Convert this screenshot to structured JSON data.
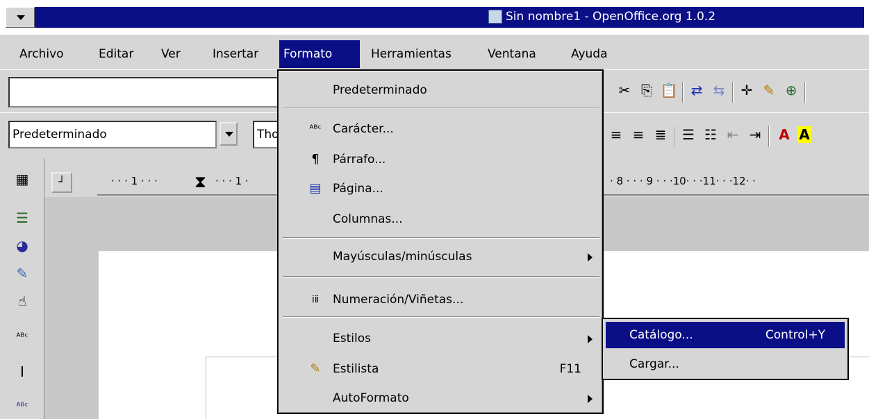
{
  "window": {
    "title": "Sin nombre1 - OpenOffice.org 1.0.2"
  },
  "menubar": {
    "items": [
      {
        "label": "Archivo"
      },
      {
        "label": "Editar"
      },
      {
        "label": "Ver"
      },
      {
        "label": "Insertar"
      },
      {
        "label": "Formato"
      },
      {
        "label": "Herramientas"
      },
      {
        "label": "Ventana"
      },
      {
        "label": "Ayuda"
      }
    ]
  },
  "toolbar": {
    "paragraph_style": "Predeterminado",
    "font_name": "Tho"
  },
  "ruler": {
    "left_text": "· · · 1 · · · ",
    "mid_text": "· · · 1 ·",
    "right_text": "· 8 · · · 9 · · ·10· · ·11· · ·12· ·"
  },
  "format_menu": {
    "items": [
      {
        "label": "Predeterminado"
      },
      {
        "label": "Carácter..."
      },
      {
        "label": "Párrafo..."
      },
      {
        "label": "Página..."
      },
      {
        "label": "Columnas..."
      },
      {
        "label": "Mayúsculas/minúsculas"
      },
      {
        "label": "Numeración/Viñetas..."
      },
      {
        "label": "Estilos"
      },
      {
        "label": "Estilista",
        "shortcut": "F11"
      },
      {
        "label": "AutoFormato"
      }
    ]
  },
  "styles_submenu": {
    "items": [
      {
        "label": "Catálogo...",
        "shortcut": "Control+Y"
      },
      {
        "label": "Cargar..."
      }
    ]
  },
  "colors": {
    "titlebar": "#0b0f86",
    "highlight": "#0b0f86",
    "chrome": "#d6d6d6"
  }
}
